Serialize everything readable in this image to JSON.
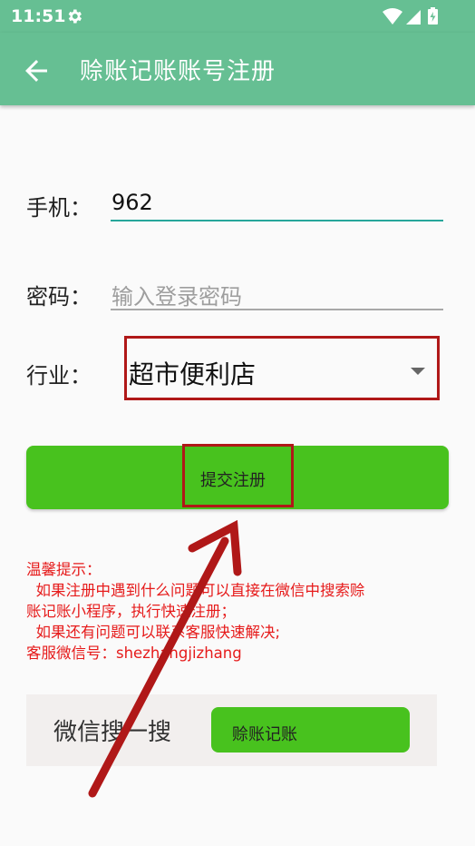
{
  "statusbar": {
    "time": "11:51"
  },
  "appbar": {
    "title": "赊账记账账号注册"
  },
  "form": {
    "phone_label": "手机：",
    "phone_value": "962",
    "password_label": "密码：",
    "password_placeholder": "输入登录密码",
    "industry_label": "行业：",
    "industry_selected": "超市便利店"
  },
  "submit": {
    "label": "提交注册"
  },
  "tips": {
    "line1": "温馨提示：",
    "line2": "  如果注册中遇到什么问题可以直接在微信中搜索赊",
    "line3": "账记账小程序，执行快速注册；",
    "line4": "  如果还有问题可以联系客服快速解决;",
    "line5": "客服微信号：shezhangjizhang"
  },
  "wechat_search": {
    "label": "微信搜一搜",
    "keyword": "赊账记账"
  },
  "colors": {
    "appbar": "#66bf93",
    "accent_teal": "#26a69a",
    "button_green": "#48c21e",
    "tip_red": "#e61b1b",
    "annotation_red": "#b01818"
  },
  "icons": {
    "status_settings": "gear-icon",
    "status_wifi": "wifi-icon",
    "status_signal": "signal-icon",
    "status_battery": "battery-charging-icon",
    "back": "arrow-left-icon",
    "dropdown": "triangle-down-icon"
  }
}
